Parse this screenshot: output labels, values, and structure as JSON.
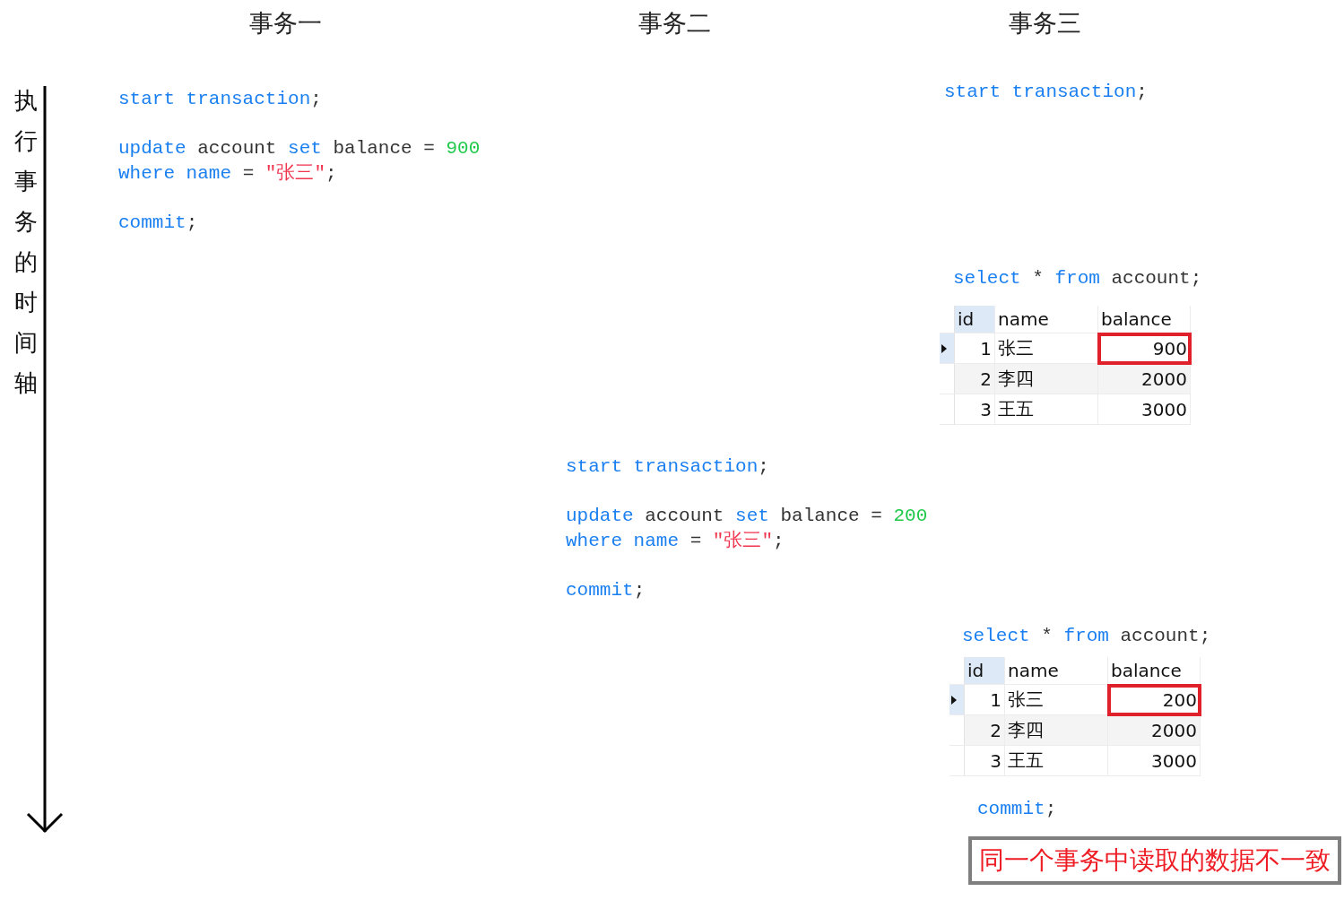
{
  "columns": [
    {
      "title": "事务一"
    },
    {
      "title": "事务二"
    },
    {
      "title": "事务三"
    }
  ],
  "timeline": {
    "label": "执行事务的时间轴"
  },
  "blocks": [
    {
      "kind": "code",
      "statements": [
        [
          [
            {
              "kind": "keyword",
              "text": "start transaction"
            },
            {
              "kind": "plain",
              "text": ";"
            }
          ]
        ],
        [
          [
            {
              "kind": "keyword",
              "text": "update"
            },
            {
              "kind": "plain",
              "text": " account "
            },
            {
              "kind": "keyword",
              "text": "set"
            },
            {
              "kind": "plain",
              "text": " balance = "
            },
            {
              "kind": "number",
              "text": "900"
            }
          ],
          [
            {
              "kind": "keyword",
              "text": "where name"
            },
            {
              "kind": "plain",
              "text": " = "
            },
            {
              "kind": "string",
              "text": "\"张三\""
            },
            {
              "kind": "plain",
              "text": ";"
            }
          ]
        ],
        [
          [
            {
              "kind": "keyword",
              "text": "commit"
            },
            {
              "kind": "plain",
              "text": ";"
            }
          ]
        ]
      ]
    },
    {
      "kind": "code",
      "statements": [
        [
          [
            {
              "kind": "keyword",
              "text": "start transaction"
            },
            {
              "kind": "plain",
              "text": ";"
            }
          ]
        ]
      ]
    },
    {
      "kind": "code",
      "statements": [
        [
          [
            {
              "kind": "keyword",
              "text": "select"
            },
            {
              "kind": "plain",
              "text": " * "
            },
            {
              "kind": "keyword",
              "text": "from"
            },
            {
              "kind": "plain",
              "text": " account;"
            }
          ]
        ]
      ]
    },
    {
      "kind": "table",
      "columns": [
        "id",
        "name",
        "balance"
      ],
      "rows": [
        {
          "id": "1",
          "name": "张三",
          "balance": "900",
          "selected": true,
          "highlighted": true
        },
        {
          "id": "2",
          "name": "李四",
          "balance": "2000",
          "selected": false,
          "highlighted": false
        },
        {
          "id": "3",
          "name": "王五",
          "balance": "3000",
          "selected": false,
          "highlighted": false
        }
      ]
    },
    {
      "kind": "code",
      "statements": [
        [
          [
            {
              "kind": "keyword",
              "text": "start transaction"
            },
            {
              "kind": "plain",
              "text": ";"
            }
          ]
        ],
        [
          [
            {
              "kind": "keyword",
              "text": "update"
            },
            {
              "kind": "plain",
              "text": " account "
            },
            {
              "kind": "keyword",
              "text": "set"
            },
            {
              "kind": "plain",
              "text": " balance = "
            },
            {
              "kind": "number",
              "text": "200"
            }
          ],
          [
            {
              "kind": "keyword",
              "text": "where name"
            },
            {
              "kind": "plain",
              "text": " = "
            },
            {
              "kind": "string",
              "text": "\"张三\""
            },
            {
              "kind": "plain",
              "text": ";"
            }
          ]
        ],
        [
          [
            {
              "kind": "keyword",
              "text": "commit"
            },
            {
              "kind": "plain",
              "text": ";"
            }
          ]
        ]
      ]
    },
    {
      "kind": "code",
      "statements": [
        [
          [
            {
              "kind": "keyword",
              "text": "select"
            },
            {
              "kind": "plain",
              "text": " * "
            },
            {
              "kind": "keyword",
              "text": "from"
            },
            {
              "kind": "plain",
              "text": " account;"
            }
          ]
        ]
      ]
    },
    {
      "kind": "table",
      "columns": [
        "id",
        "name",
        "balance"
      ],
      "rows": [
        {
          "id": "1",
          "name": "张三",
          "balance": "200",
          "selected": true,
          "highlighted": true
        },
        {
          "id": "2",
          "name": "李四",
          "balance": "2000",
          "selected": false,
          "highlighted": false
        },
        {
          "id": "3",
          "name": "王五",
          "balance": "3000",
          "selected": false,
          "highlighted": false
        }
      ]
    },
    {
      "kind": "code",
      "statements": [
        [
          [
            {
              "kind": "keyword",
              "text": "commit"
            },
            {
              "kind": "plain",
              "text": ";"
            }
          ]
        ]
      ]
    },
    {
      "kind": "note",
      "text": "同一个事务中读取的数据不一致"
    }
  ]
}
